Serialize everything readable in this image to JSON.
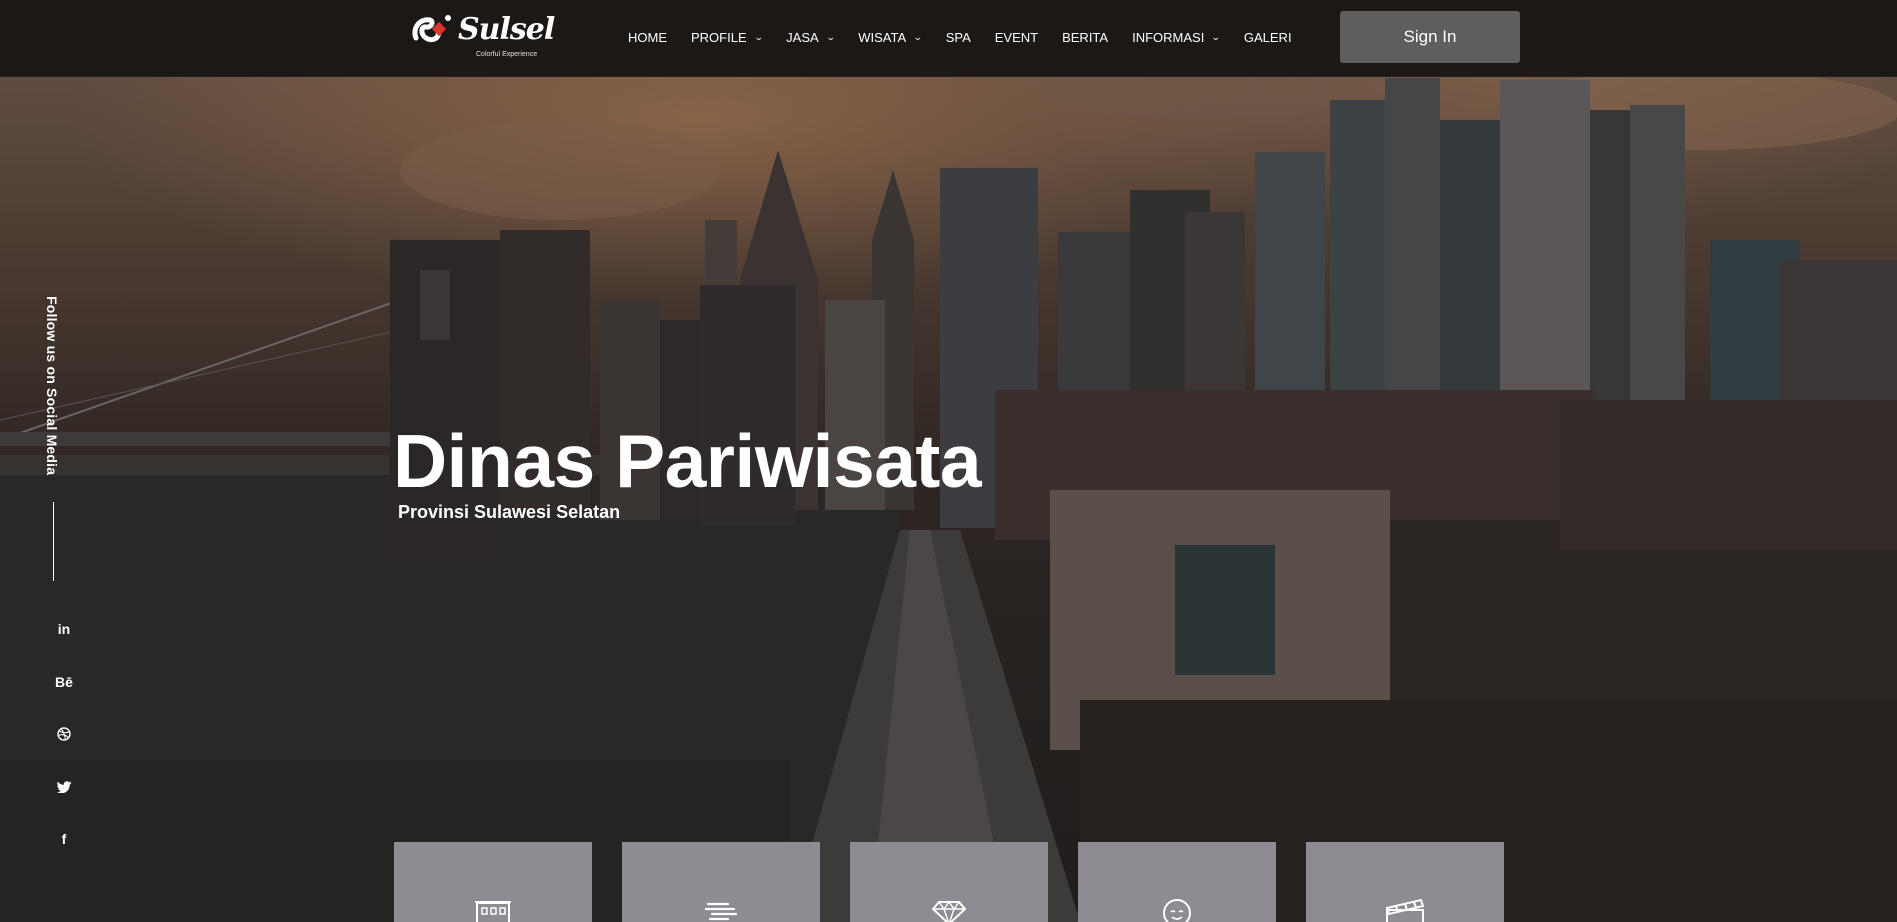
{
  "brand": {
    "logo_text": "Sulsel",
    "logo_subtitle": "Colorful Experience",
    "accent_color": "#d9382c"
  },
  "nav": {
    "items": [
      {
        "label": "HOME",
        "dropdown": false
      },
      {
        "label": "PROFILE",
        "dropdown": true
      },
      {
        "label": "JASA",
        "dropdown": true
      },
      {
        "label": "WISATA",
        "dropdown": true
      },
      {
        "label": "SPA",
        "dropdown": false
      },
      {
        "label": "EVENT",
        "dropdown": false
      },
      {
        "label": "BERITA",
        "dropdown": false
      },
      {
        "label": "INFORMASI",
        "dropdown": true
      },
      {
        "label": "GALERI",
        "dropdown": false
      }
    ],
    "signin_label": "Sign In"
  },
  "social": {
    "follow_label": "Follow us on Social Media",
    "icons": [
      {
        "name": "linkedin-icon",
        "glyph": "in"
      },
      {
        "name": "behance-icon",
        "glyph": "Bē"
      },
      {
        "name": "dribbble-icon",
        "glyph": "⊛"
      },
      {
        "name": "twitter-icon",
        "glyph": "🐦"
      },
      {
        "name": "facebook-icon",
        "glyph": "f"
      }
    ]
  },
  "hero": {
    "title": "Dinas Pariwisata",
    "subtitle": "Provinsi Sulawesi Selatan"
  },
  "cards": [
    {
      "icon": "hotel-icon"
    },
    {
      "icon": "food-icon"
    },
    {
      "icon": "diamond-icon"
    },
    {
      "icon": "spa-face-icon"
    },
    {
      "icon": "clapperboard-icon"
    }
  ]
}
